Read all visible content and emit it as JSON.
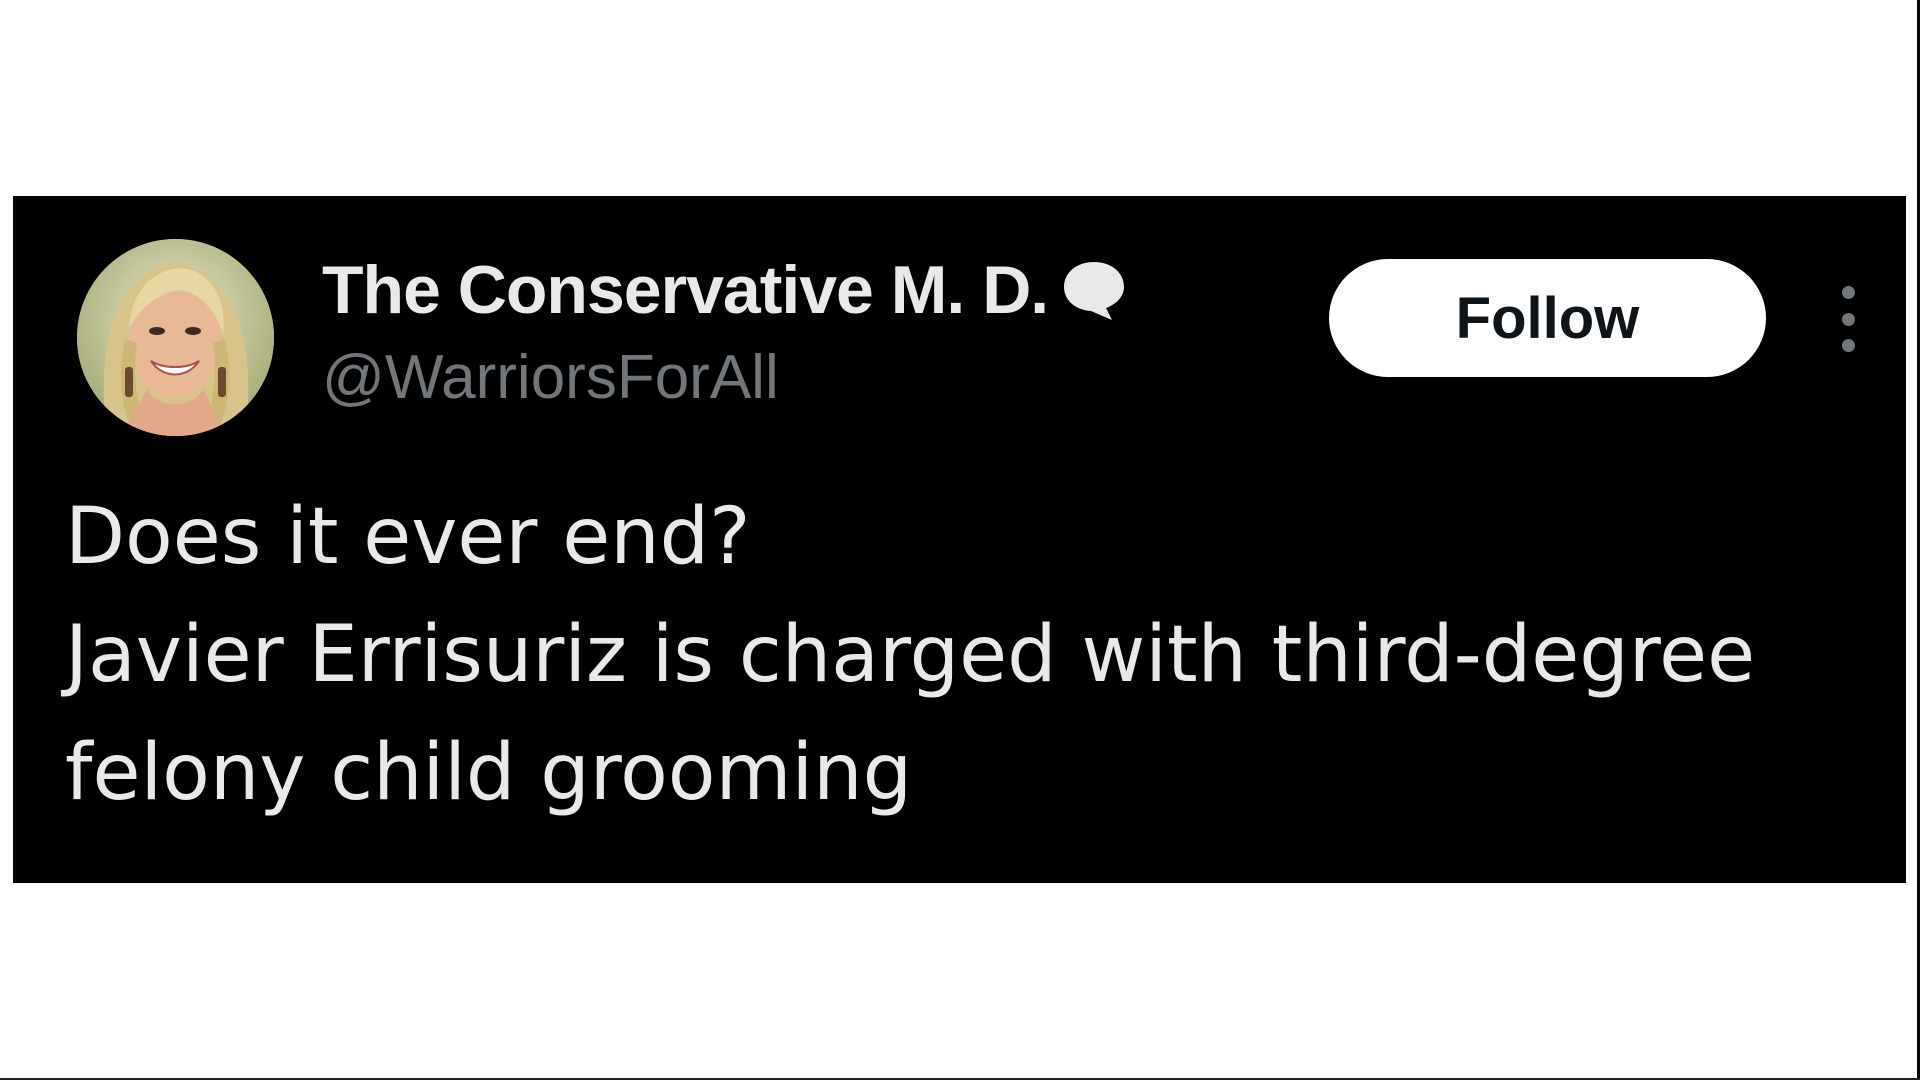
{
  "tweet": {
    "author": {
      "display_name": "The Conservative M. D.",
      "handle": "@WarriorsForAll",
      "badge_icon": "speech-bubble-icon"
    },
    "follow_label": "Follow",
    "more_icon": "more-options-icon",
    "text_lines": [
      "Does it ever end?",
      "Javier Errisuriz is charged with third-degree",
      "felony child grooming"
    ]
  },
  "colors": {
    "card_background": "#000000",
    "primary_text": "#e7e9ea",
    "secondary_text": "#71767b",
    "follow_button_bg": "#ffffff",
    "follow_button_text": "#0f1419",
    "page_background": "#ffffff"
  }
}
